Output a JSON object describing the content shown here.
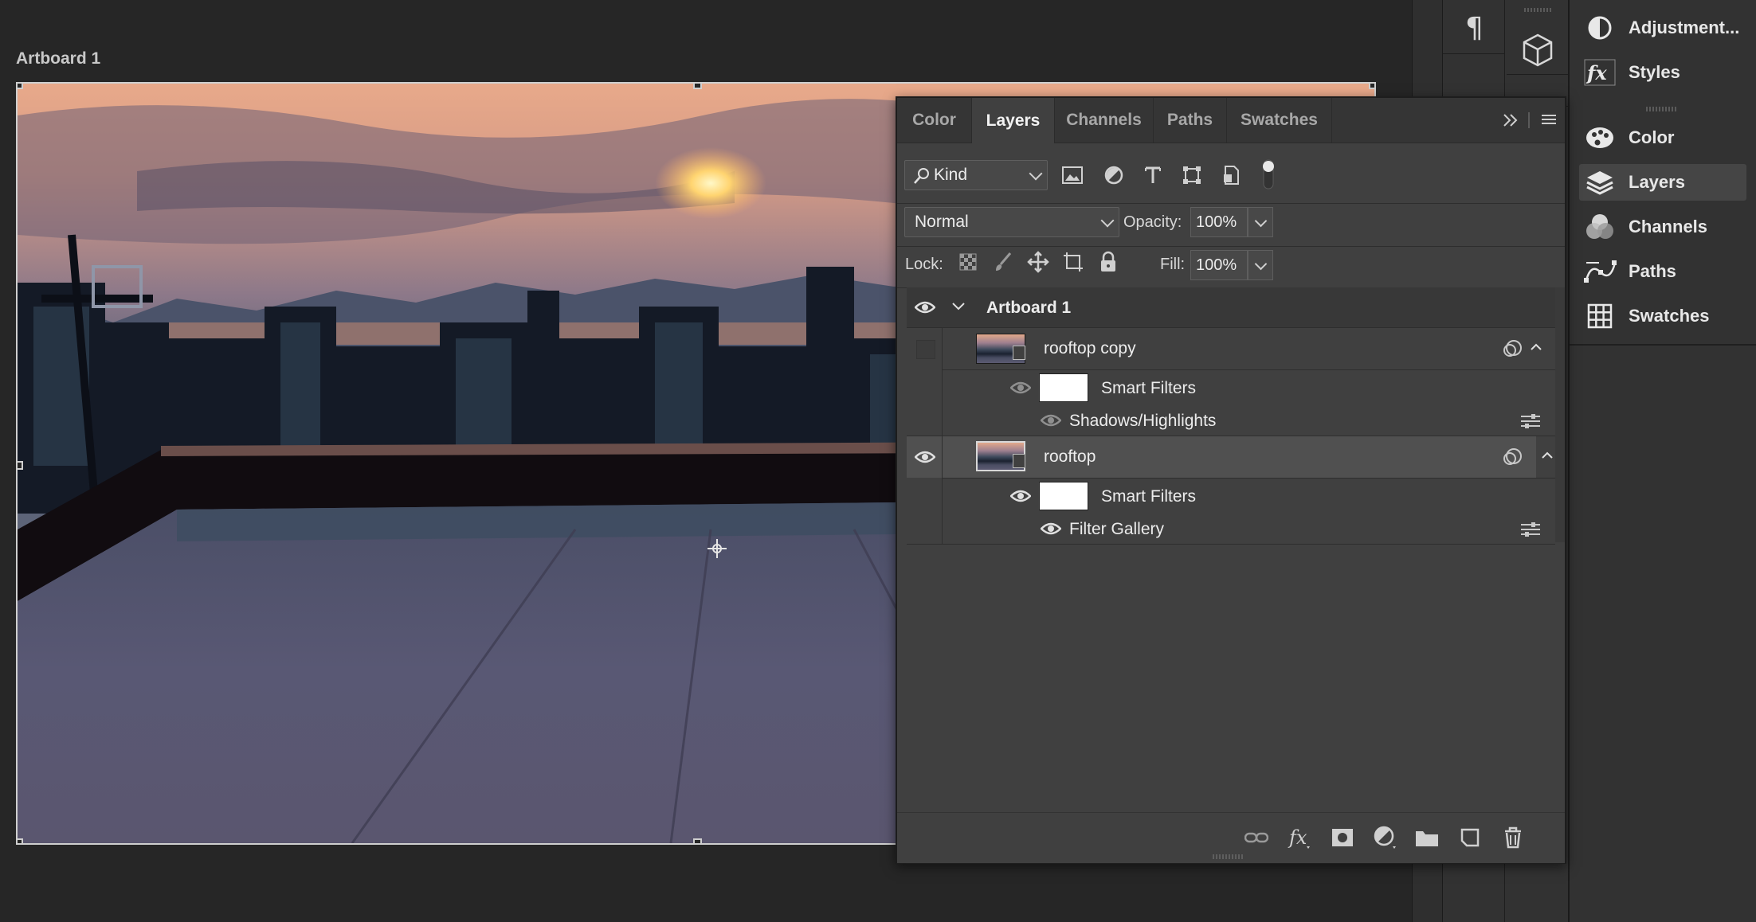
{
  "artboard": {
    "label": "Artboard 1"
  },
  "panel": {
    "tabs": [
      "Color",
      "Layers",
      "Channels",
      "Paths",
      "Swatches"
    ],
    "active_tab": "Layers",
    "filter": {
      "kind_label": "Kind"
    },
    "blend_mode": "Normal",
    "opacity_label": "Opacity:",
    "opacity_value": "100%",
    "lock_label": "Lock:",
    "fill_label": "Fill:",
    "fill_value": "100%",
    "layers": {
      "group_name": "Artboard 1",
      "layer1_name": "rooftop copy",
      "layer1_smart_filters": "Smart Filters",
      "layer1_filter": "Shadows/Highlights",
      "layer2_name": "rooftop",
      "layer2_smart_filters": "Smart Filters",
      "layer2_filter": "Filter Gallery"
    }
  },
  "dock": {
    "items": [
      "Adjustment...",
      "Styles",
      "Color",
      "Layers",
      "Channels",
      "Paths",
      "Swatches"
    ],
    "selected": "Layers"
  },
  "colors": {
    "canvas_bg": "#262626",
    "panel_bg": "#404040",
    "selected_row": "#505050",
    "text": "#ececec"
  }
}
